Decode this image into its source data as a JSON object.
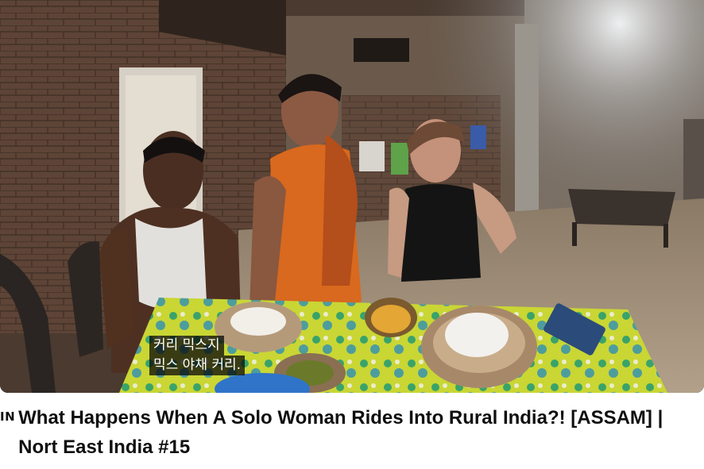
{
  "video": {
    "subtitle_lines": [
      "커리 믹스지",
      "믹스 야채 커리."
    ]
  },
  "title_area": {
    "language_badge": "IN",
    "title_line_1": "What Happens When A Solo Woman Rides Into Rural India?! [ASSAM] |",
    "title_line_2": "Nort East India #15"
  }
}
